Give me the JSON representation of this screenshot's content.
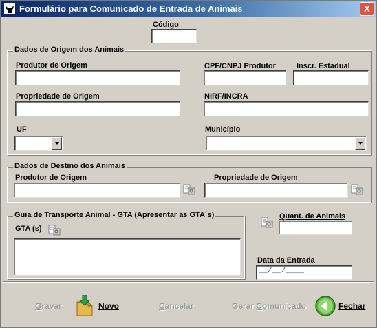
{
  "window": {
    "title": "Formulário para Comunicado de Entrada de Animais",
    "close_label": "X"
  },
  "codigo": {
    "label": "Código",
    "value": ""
  },
  "origem": {
    "group_title": "Dados de Origem dos Animais",
    "produtor_label": "Produtor de Origem",
    "cpf_label": "CPF/CNPJ Produtor",
    "inscr_label": "Inscr. Estadual",
    "propriedade_label": "Propriedade de Origem",
    "nirf_label": "NIRF/INCRA",
    "uf_label": "UF",
    "municipio_label": "Município"
  },
  "destino": {
    "group_title": "Dados de Destino dos Animais",
    "produtor_label": "Produtor de Origem",
    "propriedade_label": "Propriedade de Origem"
  },
  "gta": {
    "group_title": "Guia de Transporte Animal - GTA (Apresentar as GTA´s)",
    "label": "GTA (s)"
  },
  "quant": {
    "label": "Quant. de Animais"
  },
  "data_entrada": {
    "label": "Data da Entrada",
    "placeholder": "__/__/____"
  },
  "buttons": {
    "gravar": {
      "pre": "",
      "u": "G",
      "post": "ravar"
    },
    "novo": {
      "pre": "",
      "u": "N",
      "post": "ovo"
    },
    "cancelar": {
      "pre": "",
      "u": "C",
      "post": "ancelar"
    },
    "gerar": {
      "pre": "Gerar ",
      "u": "C",
      "post": "omunicado"
    },
    "fechar": {
      "pre": "",
      "u": "F",
      "post": "echar"
    }
  },
  "colors": {
    "title_start": "#0a246a",
    "title_end": "#a6caf0",
    "face": "#d4d0c8",
    "close": "#e0543c"
  },
  "icons": [
    "ox-icon",
    "close-icon",
    "lookup-icon",
    "new-document-icon",
    "back-arrow-icon",
    "dropdown-arrow-icon"
  ]
}
